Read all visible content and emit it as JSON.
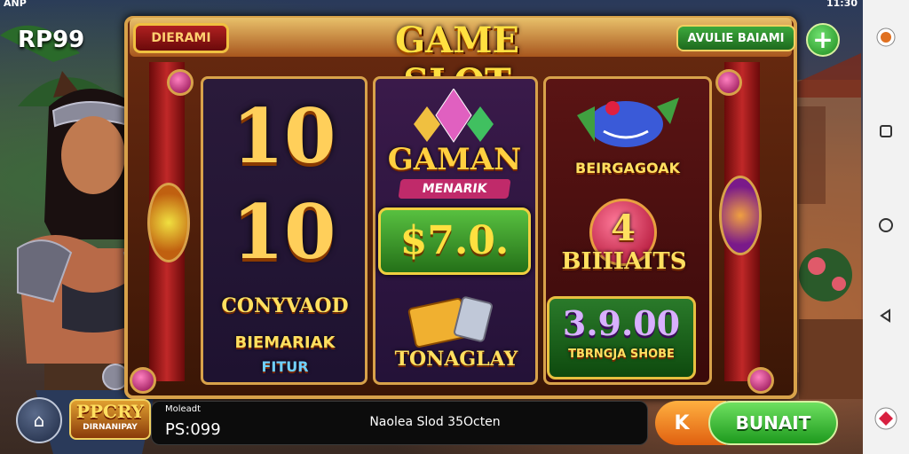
{
  "status_bar": {
    "left": "ANP",
    "time": "11:30"
  },
  "game": {
    "balance_label": "RP99",
    "title": "GAME SLOT",
    "left_tag": "DIERAMI",
    "right_tag": "AVULIE BAIAMI",
    "add_button": "+"
  },
  "reels": {
    "reel1": {
      "top_number": "10",
      "mid_number": "10",
      "line1": "CONYVAOD",
      "line2": "BIEMARIAK",
      "line3": "FITUR"
    },
    "reel2": {
      "symbol_title": "GAMAN",
      "symbol_sub": "MENARIK",
      "prize": "$7.0.",
      "bottom_label": "TONAGLAY"
    },
    "reel3": {
      "top_label": "BEIRGAGOAK",
      "orb_number": "4",
      "orb_label": "BIIIIAITS",
      "win_value": "3.9.00",
      "win_sub": "TBRNGJA SHOBE"
    }
  },
  "bottom": {
    "badge_top": "PPCRY",
    "badge_bottom": "DIRNANIPAY",
    "info_label": "Moleadt",
    "info_value": "PS:099",
    "info_message": "Naolea Slod 35Octen",
    "k_button": "K",
    "bet_button": "BUNAIT"
  },
  "colors": {
    "frame_gold": "#d8a24a",
    "title_yellow": "#ffe040",
    "green_button": "#1e9a1e",
    "orange_button": "#e06010"
  }
}
